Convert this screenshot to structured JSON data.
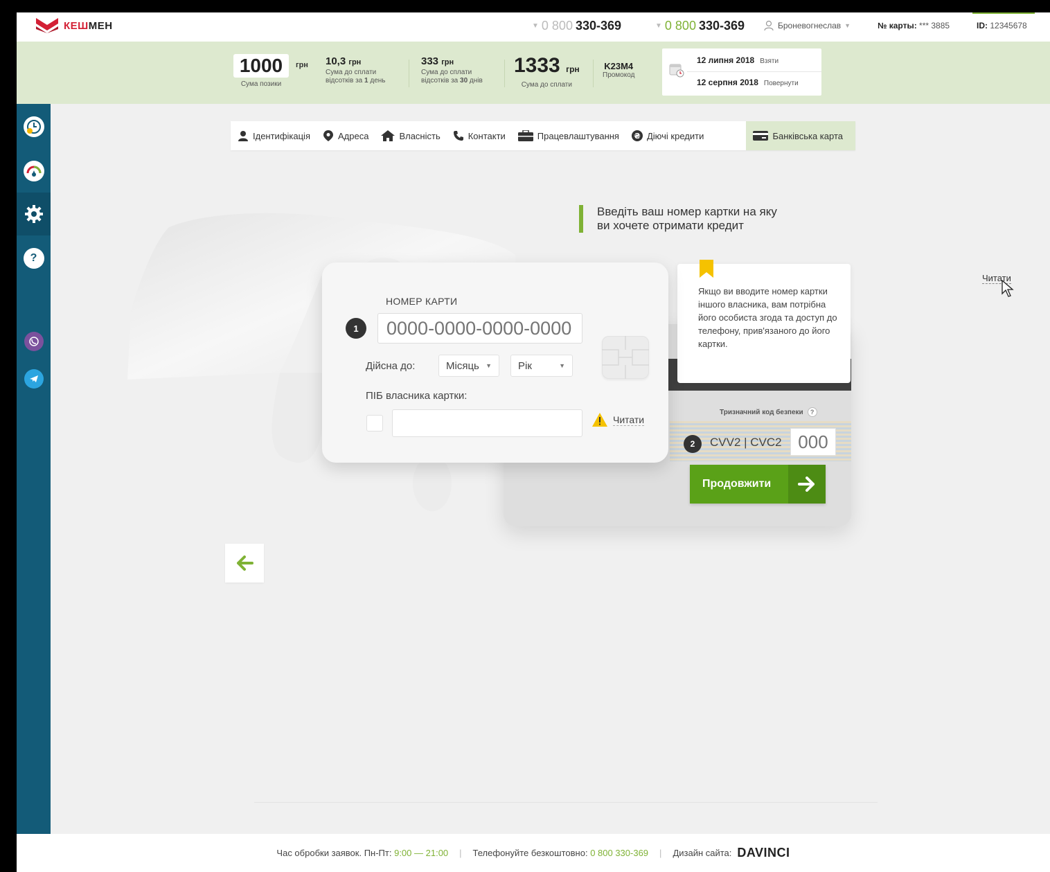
{
  "brand": {
    "logo_prefix": "КЕШ",
    "logo_suffix": "МЕН",
    "color_red": "#d32035",
    "color_green": "#7fb235"
  },
  "header": {
    "phone1_prefix": "0 800",
    "phone1_number": "330-369",
    "phone2_prefix": "0 800",
    "phone2_number": "330-369",
    "user_name": "Броневогнеслав",
    "card_label": "№ карты:",
    "card_value": "*** 3885",
    "id_label": "ID:",
    "id_value": "12345678"
  },
  "summary": {
    "loan_amount": "1000",
    "loan_currency": "грн",
    "loan_label": "Сума позики",
    "daily": {
      "amount": "10,3",
      "currency": "грн",
      "line1": "Сума до сплати",
      "line2_pre": "відсотків за ",
      "line2_bold": "1",
      "line2_post": " день"
    },
    "monthly": {
      "amount": "333",
      "currency": "грн",
      "line1": "Сума до сплати",
      "line2_pre": "відсотків за ",
      "line2_bold": "30",
      "line2_post": " днів"
    },
    "total_amount": "1333",
    "total_currency": "грн",
    "total_label": "Сума до сплати",
    "promo_code": "K23M4",
    "promo_label": "Промокод",
    "take_date": "12 липня 2018",
    "take_label": "Взяти",
    "return_date": "12 серпня 2018",
    "return_label": "Повернути"
  },
  "tabs": [
    {
      "label": "Ідентифікація",
      "icon": "user-icon"
    },
    {
      "label": "Адреса",
      "icon": "location-pin-icon"
    },
    {
      "label": "Власність",
      "icon": "house-icon"
    },
    {
      "label": "Контакти",
      "icon": "phone-icon"
    },
    {
      "label": "Працевлаштування",
      "icon": "briefcase-icon"
    },
    {
      "label": "Діючі кредити",
      "icon": "credit-icon"
    },
    {
      "label": "Банківська карта",
      "icon": "bank-card-icon",
      "active": true
    }
  ],
  "heading": {
    "line1": "Введіть ваш номер картки на яку",
    "line2": "ви хочете отримати кредит"
  },
  "card_form": {
    "step1": "1",
    "number_label": "НОМЕР КАРТИ",
    "number_placeholder": "0000-0000-0000-0000",
    "valid_label": "Дійсна до:",
    "month_value": "Місяць",
    "year_value": "Рік",
    "owner_label": "ПІБ власника картки:",
    "read_label": "Читати"
  },
  "hint": {
    "text": "Якщо ви вводите номер картки іншого власника, вам потрібна його особиста згода та доступ до телефону, прив'язаного до його картки."
  },
  "security": {
    "label": "Тризначний код безпеки",
    "question": "?",
    "step2": "2",
    "cvv_label": "CVV2 | CVC2",
    "cvv_placeholder": "000"
  },
  "continue_label": "Продовжити",
  "side_read_label": "Читати",
  "footer": {
    "hours_text": "Час обробки заявок. Пн-Пт:",
    "hours_value": "9:00 — 21:00",
    "free_text": "Телефонуйте безкоштовно:",
    "free_phone": "0 800 330-369",
    "design_text": "Дизайн сайта:",
    "design_brand": "DAVINCI"
  }
}
